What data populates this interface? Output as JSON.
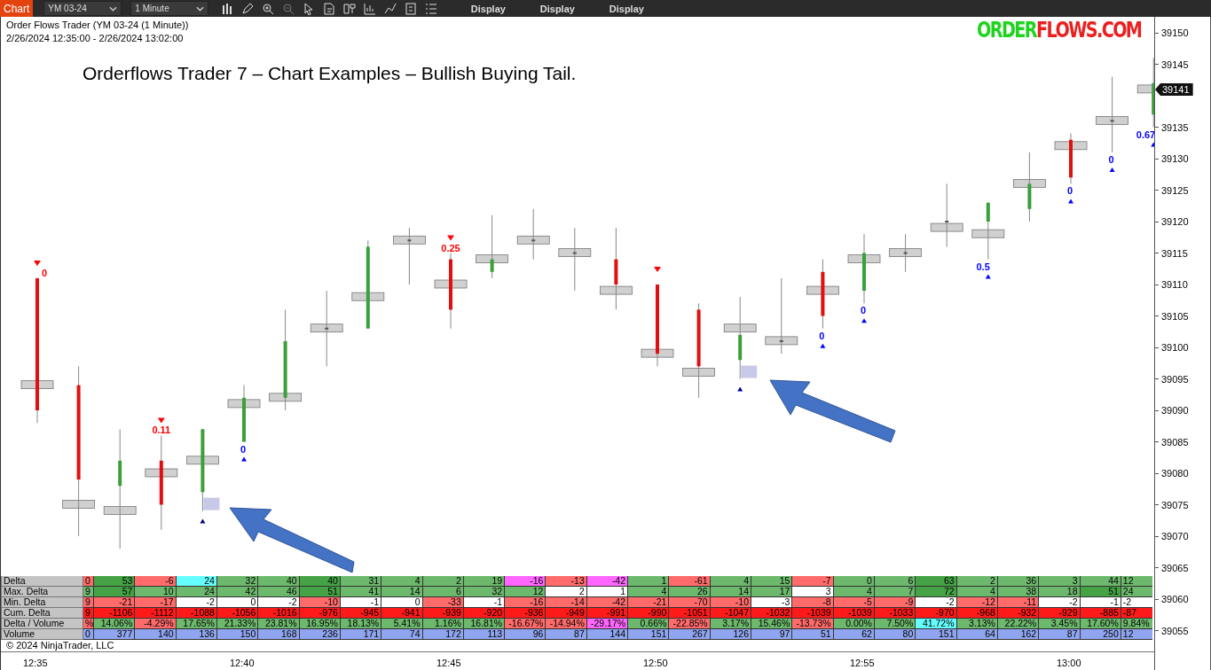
{
  "toolbar": {
    "chart_button": "Chart",
    "instrument": "YM 03-24",
    "interval": "1 Minute",
    "display_buttons": [
      "Display",
      "Display",
      "Display"
    ]
  },
  "chart": {
    "series_title": "Order Flows Trader (YM 03-24 (1 Minute))",
    "date_range": "2/26/2024 12:35:00 - 2/26/2024 13:02:00",
    "caption": "Orderflows Trader 7 – Chart Examples – Bullish Buying Tail.",
    "logo": {
      "part_1": "ORDER",
      "part_2": "FLOWS.COM"
    },
    "last_price": "39141",
    "copyright": "© 2024 NinjaTrader, LLC",
    "chart_data": {
      "type": "candlestick",
      "categories": [
        "12:35",
        null,
        null,
        null,
        null,
        "12:40",
        null,
        null,
        null,
        null,
        "12:45",
        null,
        null,
        null,
        null,
        "12:50",
        null,
        null,
        null,
        null,
        "12:55",
        null,
        null,
        null,
        null,
        "13:00",
        null,
        null
      ],
      "ohlc": [
        [
          39111,
          39111,
          39088,
          39090
        ],
        [
          39094,
          39097,
          39070,
          39079
        ],
        [
          39078,
          39087,
          39068,
          39082
        ],
        [
          39082,
          39086,
          39071,
          39075
        ],
        [
          39077,
          39087,
          39074,
          39087
        ],
        [
          39085,
          39094,
          39085,
          39092
        ],
        [
          39092,
          39106,
          39090,
          39101
        ],
        [
          39103,
          39109,
          39097,
          39103
        ],
        [
          39103,
          39117,
          39103,
          39116
        ],
        [
          39117,
          39119,
          39110,
          39117
        ],
        [
          39114,
          39115,
          39103,
          39106
        ],
        [
          39112,
          39121,
          39111,
          39114
        ],
        [
          39117,
          39122,
          39114,
          39117
        ],
        [
          39115,
          39119,
          39109,
          39115
        ],
        [
          39114,
          39119,
          39106,
          39110
        ],
        [
          39110,
          39110,
          39097,
          39099
        ],
        [
          39106,
          39107,
          39092,
          39097
        ],
        [
          39098,
          39108,
          39095,
          39102
        ],
        [
          39101,
          39111,
          39099,
          39101
        ],
        [
          39112,
          39114,
          39103,
          39105
        ],
        [
          39109,
          39118,
          39107,
          39115
        ],
        [
          39115,
          39118,
          39112,
          39115
        ],
        [
          39120,
          39126,
          39116,
          39120
        ],
        [
          39120,
          39123,
          39114,
          39123
        ],
        [
          39122,
          39131,
          39120,
          39126
        ],
        [
          39133,
          39134,
          39126,
          39127
        ],
        [
          39136,
          39143,
          39131,
          39136
        ],
        [
          39137,
          39146,
          39135,
          39142
        ]
      ],
      "ylim": [
        39052,
        39152
      ],
      "yticks": [
        39150,
        39145,
        39135,
        39130,
        39125,
        39120,
        39115,
        39110,
        39105,
        39100,
        39095,
        39090,
        39085,
        39080,
        39075,
        39070,
        39065,
        39060,
        39055
      ],
      "title": null
    },
    "bar_signals": [
      {
        "kind": "sell",
        "label": "0",
        "color": "#ff0000"
      },
      {
        "kind": "none"
      },
      {
        "kind": "none"
      },
      {
        "kind": "sell",
        "label": "0.11",
        "color": "#ff0000"
      },
      {
        "kind": "buy",
        "color": "#00008b"
      },
      {
        "kind": "buy",
        "label": "0",
        "color": "#0000ff"
      },
      {
        "kind": "none"
      },
      {
        "kind": "none"
      },
      {
        "kind": "none"
      },
      {
        "kind": "none"
      },
      {
        "kind": "sell",
        "label": "0.25",
        "color": "#ff0000"
      },
      {
        "kind": "none"
      },
      {
        "kind": "none"
      },
      {
        "kind": "none"
      },
      {
        "kind": "none"
      },
      {
        "kind": "sell",
        "color": "#ff0000"
      },
      {
        "kind": "none"
      },
      {
        "kind": "buy",
        "color": "#00008b"
      },
      {
        "kind": "none"
      },
      {
        "kind": "buy",
        "label": "0",
        "color": "#0000ff"
      },
      {
        "kind": "buy",
        "label": "0",
        "color": "#0000ff"
      },
      {
        "kind": "none"
      },
      {
        "kind": "none"
      },
      {
        "kind": "buy",
        "label": "0.5",
        "color": "#0000ff"
      },
      {
        "kind": "none"
      },
      {
        "kind": "buy",
        "label": "0",
        "color": "#0000ff"
      },
      {
        "kind": "buy",
        "label": "0",
        "color": "#0000ff"
      },
      {
        "kind": "buy",
        "label": "0.67",
        "color": "#0000ff"
      }
    ]
  },
  "table": {
    "rows": [
      {
        "label": "Delta",
        "cells": [
          {
            "text": "0",
            "color": "#ff6b6b"
          },
          {
            "text": "53",
            "color": "#45a345"
          },
          {
            "text": "-6",
            "color": "#ff6b6b"
          },
          {
            "text": "24",
            "color": "#66ffff"
          },
          {
            "text": "32",
            "color": "#6cb86c"
          },
          {
            "text": "40",
            "color": "#6cb86c"
          },
          {
            "text": "40",
            "color": "#45a345"
          },
          {
            "text": "31",
            "color": "#6cb86c"
          },
          {
            "text": "4",
            "color": "#6cb86c"
          },
          {
            "text": "2",
            "color": "#6cb86c"
          },
          {
            "text": "19",
            "color": "#6cb86c"
          },
          {
            "text": "-16",
            "color": "#ff66ff"
          },
          {
            "text": "-13",
            "color": "#ff6b6b"
          },
          {
            "text": "-42",
            "color": "#ff66ff"
          },
          {
            "text": "1",
            "color": "#6cb86c"
          },
          {
            "text": "-61",
            "color": "#ff6b6b"
          },
          {
            "text": "4",
            "color": "#6cb86c"
          },
          {
            "text": "15",
            "color": "#6cb86c"
          },
          {
            "text": "-7",
            "color": "#ff6b6b"
          },
          {
            "text": "0",
            "color": "#6cb86c"
          },
          {
            "text": "6",
            "color": "#6cb86c"
          },
          {
            "text": "63",
            "color": "#45a345"
          },
          {
            "text": "2",
            "color": "#6cb86c"
          },
          {
            "text": "36",
            "color": "#6cb86c"
          },
          {
            "text": "3",
            "color": "#6cb86c"
          },
          {
            "text": "44",
            "color": "#6cb86c"
          },
          {
            "text": "12",
            "color": "#6cb86c"
          }
        ]
      },
      {
        "label": "Max. Delta",
        "cells": [
          {
            "text": "9",
            "color": "#6cb86c"
          },
          {
            "text": "57",
            "color": "#45a345"
          },
          {
            "text": "10",
            "color": "#6cb86c"
          },
          {
            "text": "24",
            "color": "#6cb86c"
          },
          {
            "text": "42",
            "color": "#6cb86c"
          },
          {
            "text": "46",
            "color": "#6cb86c"
          },
          {
            "text": "51",
            "color": "#45a345"
          },
          {
            "text": "41",
            "color": "#6cb86c"
          },
          {
            "text": "14",
            "color": "#6cb86c"
          },
          {
            "text": "6",
            "color": "#6cb86c"
          },
          {
            "text": "32",
            "color": "#6cb86c"
          },
          {
            "text": "12",
            "color": "#6cb86c"
          },
          {
            "text": "2",
            "color": "#ffffff"
          },
          {
            "text": "1",
            "color": "#ffffff"
          },
          {
            "text": "4",
            "color": "#6cb86c"
          },
          {
            "text": "26",
            "color": "#6cb86c"
          },
          {
            "text": "14",
            "color": "#6cb86c"
          },
          {
            "text": "17",
            "color": "#6cb86c"
          },
          {
            "text": "3",
            "color": "#ffffff"
          },
          {
            "text": "4",
            "color": "#6cb86c"
          },
          {
            "text": "7",
            "color": "#6cb86c"
          },
          {
            "text": "72",
            "color": "#45a345"
          },
          {
            "text": "4",
            "color": "#6cb86c"
          },
          {
            "text": "38",
            "color": "#6cb86c"
          },
          {
            "text": "18",
            "color": "#6cb86c"
          },
          {
            "text": "51",
            "color": "#45a345"
          },
          {
            "text": "24",
            "color": "#6cb86c"
          }
        ]
      },
      {
        "label": "Min. Delta",
        "cells": [
          {
            "text": "9",
            "color": "#ff6b6b"
          },
          {
            "text": "-21",
            "color": "#ff6b6b"
          },
          {
            "text": "-17",
            "color": "#ff6b6b"
          },
          {
            "text": "-2",
            "color": "#ffffff"
          },
          {
            "text": "0",
            "color": "#ffffff"
          },
          {
            "text": "-2",
            "color": "#ffffff"
          },
          {
            "text": "-10",
            "color": "#ff6b6b"
          },
          {
            "text": "-1",
            "color": "#ffffff"
          },
          {
            "text": "0",
            "color": "#ffffff"
          },
          {
            "text": "-33",
            "color": "#ff6b6b"
          },
          {
            "text": "-1",
            "color": "#ffffff"
          },
          {
            "text": "-16",
            "color": "#ff6b6b"
          },
          {
            "text": "-14",
            "color": "#ff6b6b"
          },
          {
            "text": "-42",
            "color": "#ff6b6b"
          },
          {
            "text": "-21",
            "color": "#ff6b6b"
          },
          {
            "text": "-70",
            "color": "#ff6b6b"
          },
          {
            "text": "-10",
            "color": "#ff6b6b"
          },
          {
            "text": "-3",
            "color": "#ffffff"
          },
          {
            "text": "-8",
            "color": "#ff6b6b"
          },
          {
            "text": "-5",
            "color": "#ff6b6b"
          },
          {
            "text": "-9",
            "color": "#ff6b6b"
          },
          {
            "text": "-2",
            "color": "#ffffff"
          },
          {
            "text": "-12",
            "color": "#ff6b6b"
          },
          {
            "text": "-11",
            "color": "#ff6b6b"
          },
          {
            "text": "-2",
            "color": "#ffffff"
          },
          {
            "text": "-1",
            "color": "#ffffff"
          },
          {
            "text": "-2",
            "color": "#ffffff"
          }
        ]
      },
      {
        "label": "Cum. Delta",
        "cells": [
          {
            "text": "9",
            "color": "#ff1a1a"
          },
          {
            "text": "-1106",
            "color": "#ff1a1a"
          },
          {
            "text": "-1112",
            "color": "#ff1a1a"
          },
          {
            "text": "-1088",
            "color": "#ff1a1a"
          },
          {
            "text": "-1056",
            "color": "#ff1a1a"
          },
          {
            "text": "-1016",
            "color": "#ff1a1a"
          },
          {
            "text": "-976",
            "color": "#ff1a1a"
          },
          {
            "text": "-945",
            "color": "#ff1a1a"
          },
          {
            "text": "-941",
            "color": "#ff1a1a"
          },
          {
            "text": "-939",
            "color": "#ff1a1a"
          },
          {
            "text": "-920",
            "color": "#ff1a1a"
          },
          {
            "text": "-936",
            "color": "#ff1a1a"
          },
          {
            "text": "-949",
            "color": "#ff1a1a"
          },
          {
            "text": "-991",
            "color": "#ff1a1a"
          },
          {
            "text": "-990",
            "color": "#ff1a1a"
          },
          {
            "text": "-1051",
            "color": "#ff1a1a"
          },
          {
            "text": "-1047",
            "color": "#ff1a1a"
          },
          {
            "text": "-1032",
            "color": "#ff1a1a"
          },
          {
            "text": "-1039",
            "color": "#ff1a1a"
          },
          {
            "text": "-1039",
            "color": "#ff1a1a"
          },
          {
            "text": "-1033",
            "color": "#ff1a1a"
          },
          {
            "text": "-970",
            "color": "#ff1a1a"
          },
          {
            "text": "-968",
            "color": "#ff1a1a"
          },
          {
            "text": "-932",
            "color": "#ff1a1a"
          },
          {
            "text": "-929",
            "color": "#ff1a1a"
          },
          {
            "text": "-885",
            "color": "#ff1a1a"
          },
          {
            "text": "-87",
            "color": "#ff1a1a"
          }
        ]
      },
      {
        "label": "Delta / Volume",
        "cells": [
          {
            "text": "%",
            "color": "#ff6b6b"
          },
          {
            "text": "14.06%",
            "color": "#6cb86c"
          },
          {
            "text": "-4.29%",
            "color": "#ff6b6b"
          },
          {
            "text": "17.65%",
            "color": "#6cb86c"
          },
          {
            "text": "21.33%",
            "color": "#6cb86c"
          },
          {
            "text": "23.81%",
            "color": "#6cb86c"
          },
          {
            "text": "16.95%",
            "color": "#6cb86c"
          },
          {
            "text": "18.13%",
            "color": "#6cb86c"
          },
          {
            "text": "5.41%",
            "color": "#6cb86c"
          },
          {
            "text": "1.16%",
            "color": "#6cb86c"
          },
          {
            "text": "16.81%",
            "color": "#6cb86c"
          },
          {
            "text": "-16.67%",
            "color": "#ff6b6b"
          },
          {
            "text": "-14.94%",
            "color": "#ff6b6b"
          },
          {
            "text": "-29.17%",
            "color": "#ff66ff"
          },
          {
            "text": "0.66%",
            "color": "#6cb86c"
          },
          {
            "text": "-22.85%",
            "color": "#ff6b6b"
          },
          {
            "text": "3.17%",
            "color": "#6cb86c"
          },
          {
            "text": "15.46%",
            "color": "#6cb86c"
          },
          {
            "text": "-13.73%",
            "color": "#ff6b6b"
          },
          {
            "text": "0.00%",
            "color": "#6cb86c"
          },
          {
            "text": "7.50%",
            "color": "#6cb86c"
          },
          {
            "text": "41.72%",
            "color": "#66ffff"
          },
          {
            "text": "3.13%",
            "color": "#6cb86c"
          },
          {
            "text": "22.22%",
            "color": "#6cb86c"
          },
          {
            "text": "3.45%",
            "color": "#6cb86c"
          },
          {
            "text": "17.60%",
            "color": "#6cb86c"
          },
          {
            "text": "9.84%",
            "color": "#6cb86c"
          }
        ]
      },
      {
        "label": "Volume",
        "cells": [
          {
            "text": "0",
            "color": "#8fa5ef"
          },
          {
            "text": "377",
            "color": "#8fa5ef"
          },
          {
            "text": "140",
            "color": "#8fa5ef"
          },
          {
            "text": "136",
            "color": "#8fa5ef"
          },
          {
            "text": "150",
            "color": "#8fa5ef"
          },
          {
            "text": "168",
            "color": "#8fa5ef"
          },
          {
            "text": "236",
            "color": "#8fa5ef"
          },
          {
            "text": "171",
            "color": "#8fa5ef"
          },
          {
            "text": "74",
            "color": "#8fa5ef"
          },
          {
            "text": "172",
            "color": "#8fa5ef"
          },
          {
            "text": "113",
            "color": "#8fa5ef"
          },
          {
            "text": "96",
            "color": "#8fa5ef"
          },
          {
            "text": "87",
            "color": "#8fa5ef"
          },
          {
            "text": "144",
            "color": "#8fa5ef"
          },
          {
            "text": "151",
            "color": "#8fa5ef"
          },
          {
            "text": "267",
            "color": "#8fa5ef"
          },
          {
            "text": "126",
            "color": "#8fa5ef"
          },
          {
            "text": "97",
            "color": "#8fa5ef"
          },
          {
            "text": "51",
            "color": "#8fa5ef"
          },
          {
            "text": "62",
            "color": "#8fa5ef"
          },
          {
            "text": "80",
            "color": "#8fa5ef"
          },
          {
            "text": "151",
            "color": "#8fa5ef"
          },
          {
            "text": "64",
            "color": "#8fa5ef"
          },
          {
            "text": "162",
            "color": "#8fa5ef"
          },
          {
            "text": "87",
            "color": "#8fa5ef"
          },
          {
            "text": "250",
            "color": "#8fa5ef"
          },
          {
            "text": "12",
            "color": "#8fa5ef"
          }
        ]
      }
    ]
  }
}
